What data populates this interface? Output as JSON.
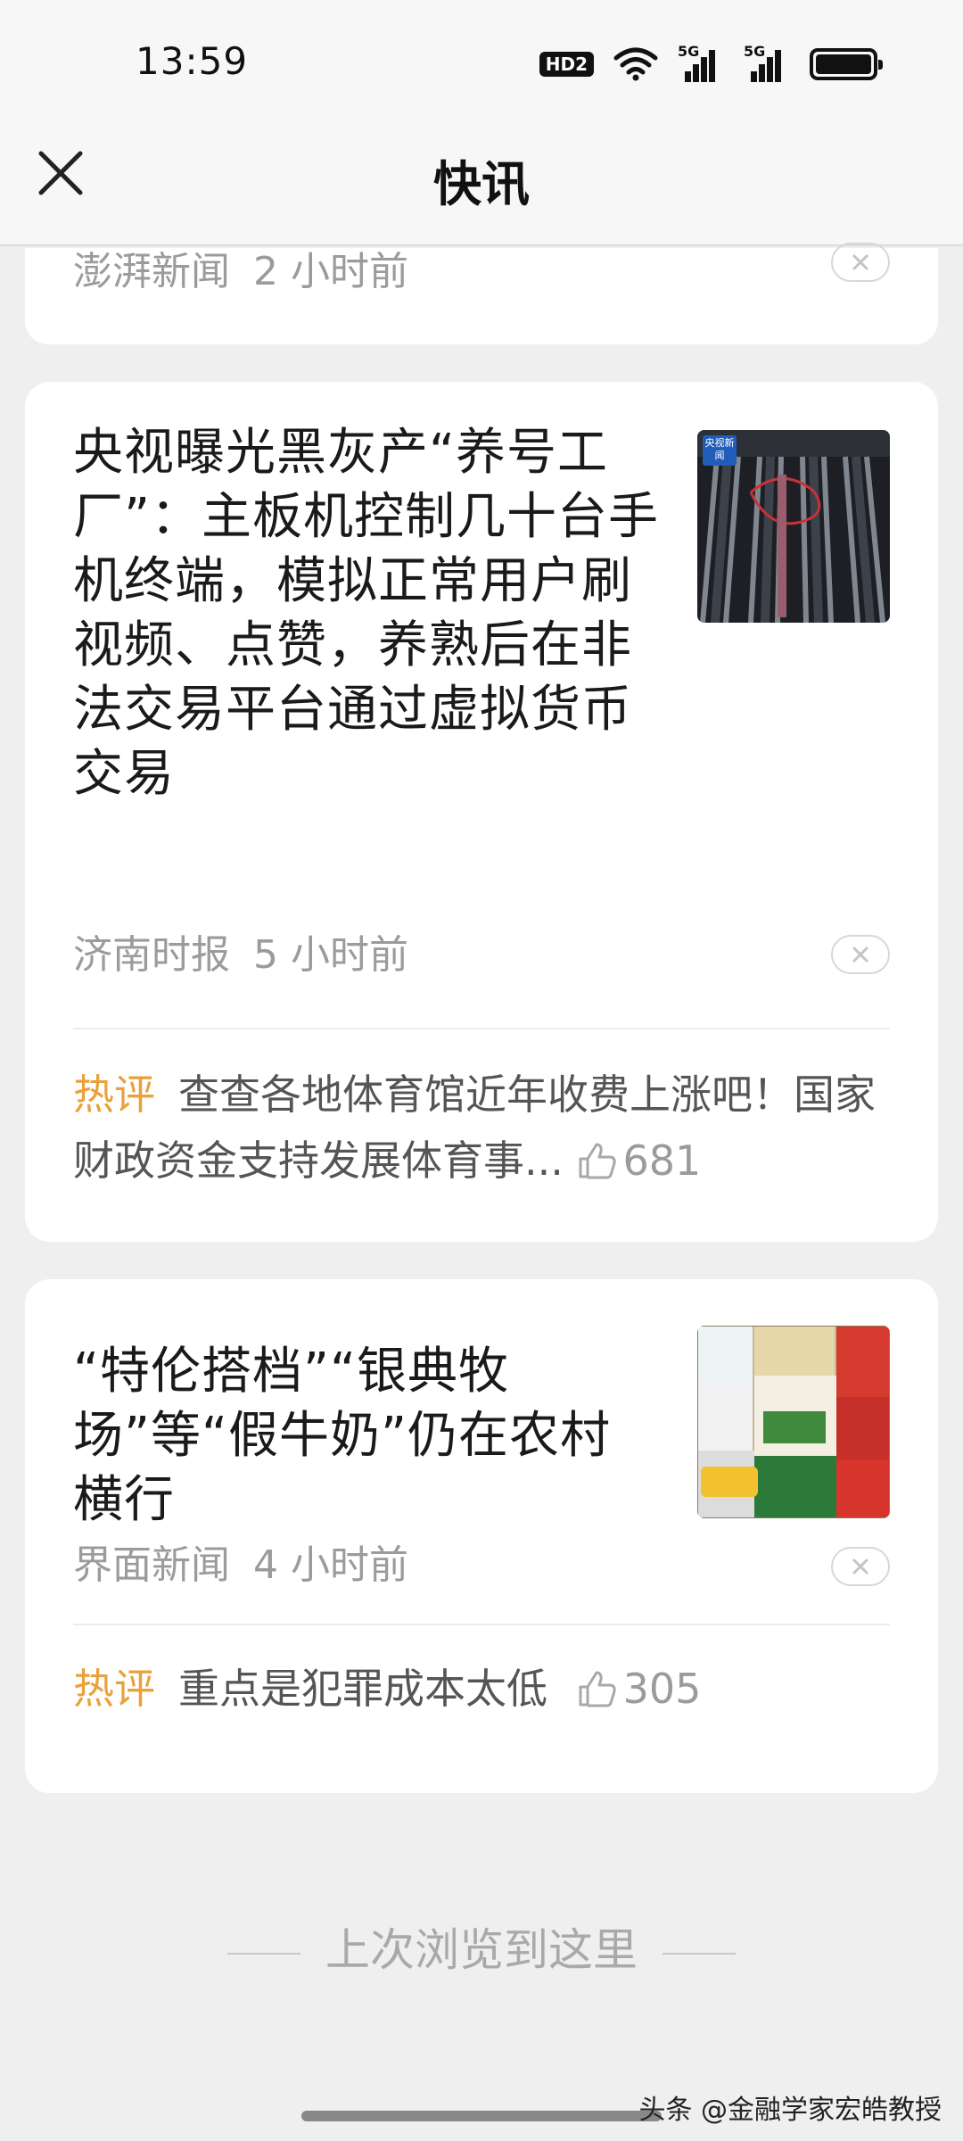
{
  "status_bar": {
    "time": "13:59",
    "hd_badge": "HD2",
    "network_1": "5G",
    "network_2": "5G",
    "icons": [
      "hd-voice-icon",
      "wifi-icon",
      "cellular-signal-icon",
      "cellular-signal-icon",
      "battery-icon"
    ]
  },
  "header": {
    "title": "快讯",
    "close_icon": "close-icon"
  },
  "partial_item": {
    "source": "澎湃新闻",
    "time": "2 小时前"
  },
  "news_items": [
    {
      "headline": "央视曝光黑灰产“养号工厂”：主板机控制几十台手机终端，模拟正常用户刷视频、点赞，养熟后在非法交易平台通过虚拟货币交易",
      "source": "济南时报",
      "time": "5 小时前",
      "thumb_badge": "央视新闻",
      "hot_comment": {
        "label": "热评",
        "text": "查查各地体育馆近年收费上涨吧！国家财政资金支持发展体育事...",
        "likes": "681"
      }
    },
    {
      "headline": "“特伦搭档”“银典牧场”等“假牛奶”仍在农村横行",
      "source": "界面新闻",
      "time": "4 小时前",
      "hot_comment": {
        "label": "热评",
        "text": "重点是犯罪成本太低",
        "likes": "305"
      }
    }
  ],
  "footer": {
    "last_viewed": "上次浏览到这里",
    "watermark": "头条 @金融学家宏皓教授"
  },
  "colors": {
    "hot_label": "#e9a13b",
    "meta_gray": "#9b9b9b",
    "background": "#efefef"
  }
}
